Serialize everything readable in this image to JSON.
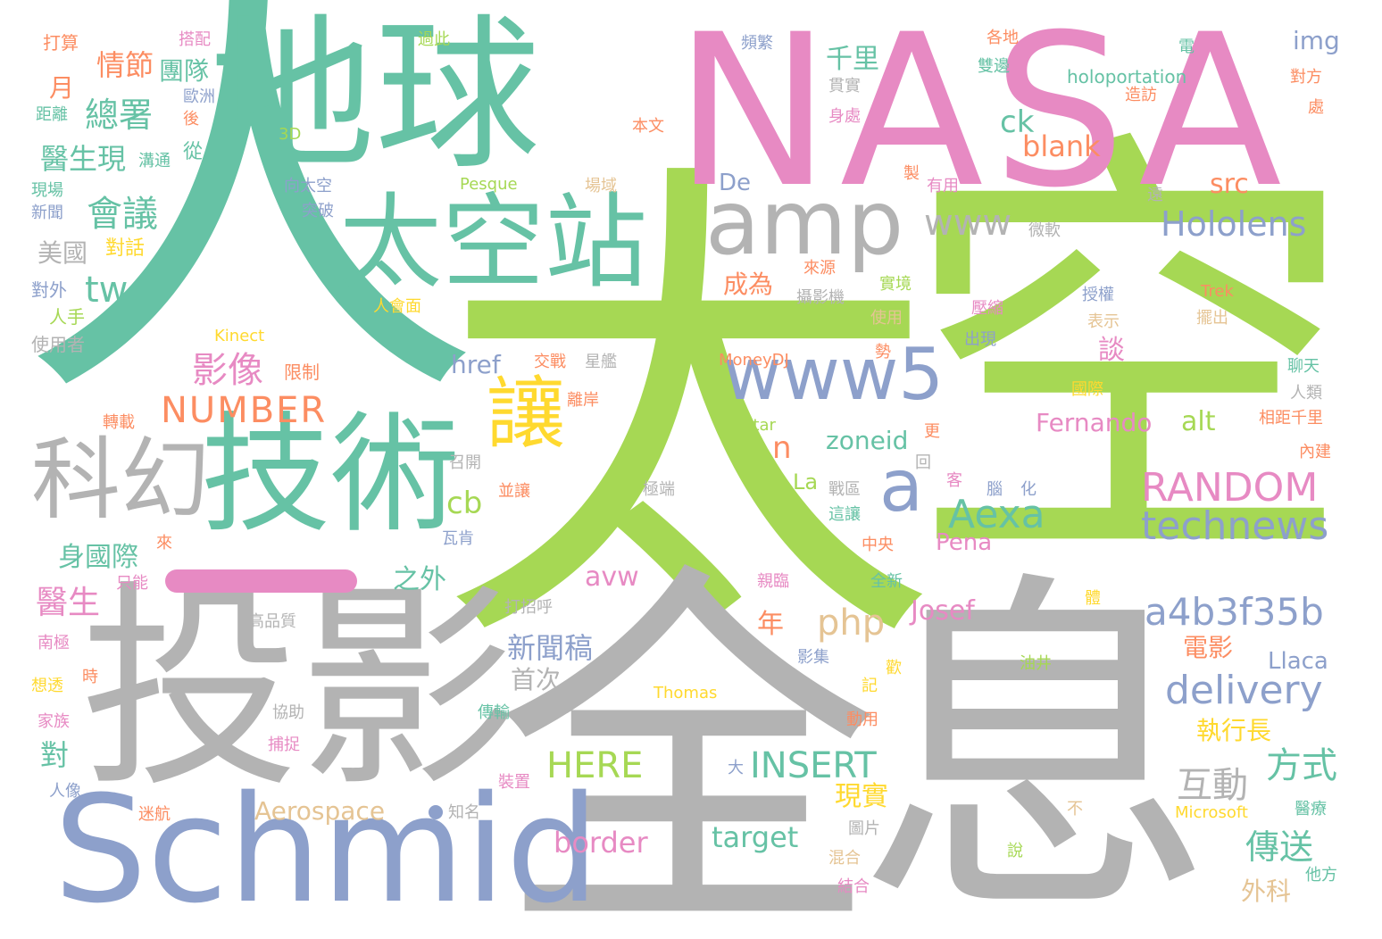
{
  "palette": {
    "green": "#66c2a5",
    "lime": "#a6d854",
    "pink": "#e78ac3",
    "gray": "#b3b3b3",
    "blue": "#8da0cb",
    "orange": "#fc8d62",
    "yellow": "#ffd92f",
    "tan": "#e5c494"
  },
  "words": [
    "人",
    "太",
    "空",
    "NASA",
    "地球",
    "全",
    "息",
    "投影",
    "Schmid",
    "技術",
    "太空站",
    "amp",
    "科幻",
    "讓",
    "www5",
    "a",
    "Aexa",
    "technews",
    "RANDOM",
    "Hololens",
    "a4b3f35b",
    "delivery",
    "www",
    "tw",
    "php",
    "NUMBER",
    "影像",
    "會議",
    "總署",
    "醫生現",
    "情節",
    "團隊",
    "美國",
    "身國際",
    "醫生",
    "互動",
    "方式",
    "傳送",
    "執行長",
    "HERE",
    "INSERT",
    "border",
    "target",
    "Aerospace",
    "新聞稿",
    "首次",
    "avw",
    "cb",
    "n",
    "zoneid",
    "Fernando",
    "alt",
    "Josef",
    "Pena",
    "Llaca",
    "電影",
    "ck",
    "blank",
    "src",
    "img",
    "千里",
    "月",
    "之外",
    "現實",
    "成為",
    "外科",
    "年",
    "對",
    "談",
    "De",
    "La",
    "holoportation",
    "href",
    "對話",
    "對外",
    "人手",
    "使用者",
    "限制",
    "轉載",
    "只能",
    "高品質",
    "南極",
    "想透",
    "家族",
    "人像",
    "迷航",
    "知名",
    "裝置",
    "傳輸",
    "捕捉",
    "協助",
    "時",
    "打招呼",
    "瓦肯",
    "並讓",
    "召開",
    "極端",
    "離岸",
    "交戰",
    "星艦",
    "人會面",
    "Kinect",
    "Pesque",
    "3D",
    "向太空",
    "突破",
    "本文",
    "場域",
    "過此",
    "搭配",
    "打算",
    "歐洲",
    "後",
    "距離",
    "溝通",
    "現場",
    "新聞",
    "從",
    "頻繁",
    "各地",
    "雙邊",
    "電",
    "對方",
    "貫實",
    "身處",
    "處",
    "造訪",
    "製",
    "有用",
    "遠",
    "微軟",
    "實境",
    "授權",
    "Trek",
    "壓縮",
    "擺出",
    "攝影機",
    "來源",
    "使用",
    "表示",
    "出現",
    "勢",
    "MoneyDJ",
    "Star",
    "國際",
    "聊天",
    "人類",
    "相距千里",
    "內建",
    "更",
    "回",
    "客",
    "腦",
    "化",
    "戰區",
    "這讓",
    "中央",
    "全新",
    "親臨",
    "影集",
    "記",
    "歡",
    "動用",
    "Thomas",
    "Microsoft",
    "醫療",
    "不",
    "圖片",
    "混合",
    "結合",
    "說",
    "他方",
    "油井",
    "大",
    "來",
    "體"
  ]
}
